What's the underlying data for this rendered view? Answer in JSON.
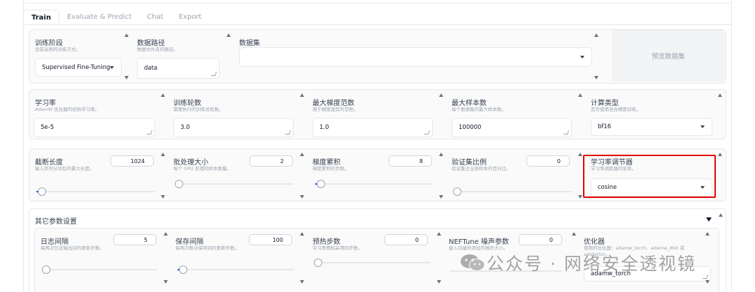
{
  "tabs": [
    "Train",
    "Evaluate & Predict",
    "Chat",
    "Export"
  ],
  "row1": {
    "stage": {
      "label": "训练阶段",
      "desc": "目前采用的训练方式。",
      "value": "Supervised Fine-Tuning"
    },
    "data_dir": {
      "label": "数据路径",
      "desc": "数据文件夹的路径。",
      "value": "data"
    },
    "dataset": {
      "label": "数据集",
      "value": ""
    },
    "preview_button": "预览数据集"
  },
  "row2": {
    "lr": {
      "label": "学习率",
      "desc": "AdamW 优化器的初始学习率。",
      "value": "5e-5"
    },
    "epochs": {
      "label": "训练轮数",
      "desc": "需要执行的训练总轮数。",
      "value": "3.0"
    },
    "max_grad_norm": {
      "label": "最大梯度范数",
      "desc": "用于梯度裁剪的范数。",
      "value": "1.0"
    },
    "max_samples": {
      "label": "最大样本数",
      "desc": "每个数据集的最大样本数。",
      "value": "100000"
    },
    "compute_type": {
      "label": "计算类型",
      "desc": "是否使用混合精度训练。",
      "value": "bf16"
    }
  },
  "row3": {
    "cutoff_len": {
      "label": "截断长度",
      "desc": "输入序列分词后的最大长度。",
      "value": "1024",
      "level": 0.03
    },
    "batch_size": {
      "label": "批处理大小",
      "desc": "每个 GPU 处理的样本数量。",
      "value": "2",
      "level": 0.0
    },
    "grad_accum": {
      "label": "梯度累积",
      "desc": "梯度累积的步数。",
      "value": "8",
      "level": 0.04
    },
    "val_size": {
      "label": "验证集比例",
      "desc": "验证集占全部样本的百分比。",
      "value": "0",
      "level": 0.0
    },
    "lr_scheduler": {
      "label": "学习率调节器",
      "desc": "学习率调度器的名称。",
      "value": "cosine"
    }
  },
  "row4": {
    "title": "其它参数设置",
    "logging_steps": {
      "label": "日志间隔",
      "desc": "每两次日志输出间的更新步数。",
      "value": "5",
      "level": 0.0
    },
    "save_steps": {
      "label": "保存间隔",
      "desc": "每两次断点保存间的更新步数。",
      "value": "100",
      "level": 0.02
    },
    "warmup_steps": {
      "label": "预热步数",
      "desc": "学习率预热采用的步数。",
      "value": "0",
      "level": 0.0
    },
    "neftune": {
      "label": "NEFTune 噪声参数",
      "desc": "嵌入向量所添加的噪声大小。",
      "value": "0"
    },
    "optim": {
      "label": "优化器",
      "desc": "使用的优化器：adamw_torch、adamw_8bit 或 adafactor。",
      "value": "adamw_torch"
    }
  },
  "watermark": "公众号 · 网络安全透视镜",
  "colors": {
    "highlight": "#e60000",
    "active_tab_text": "#111827",
    "slider_fill": "#2563eb"
  }
}
